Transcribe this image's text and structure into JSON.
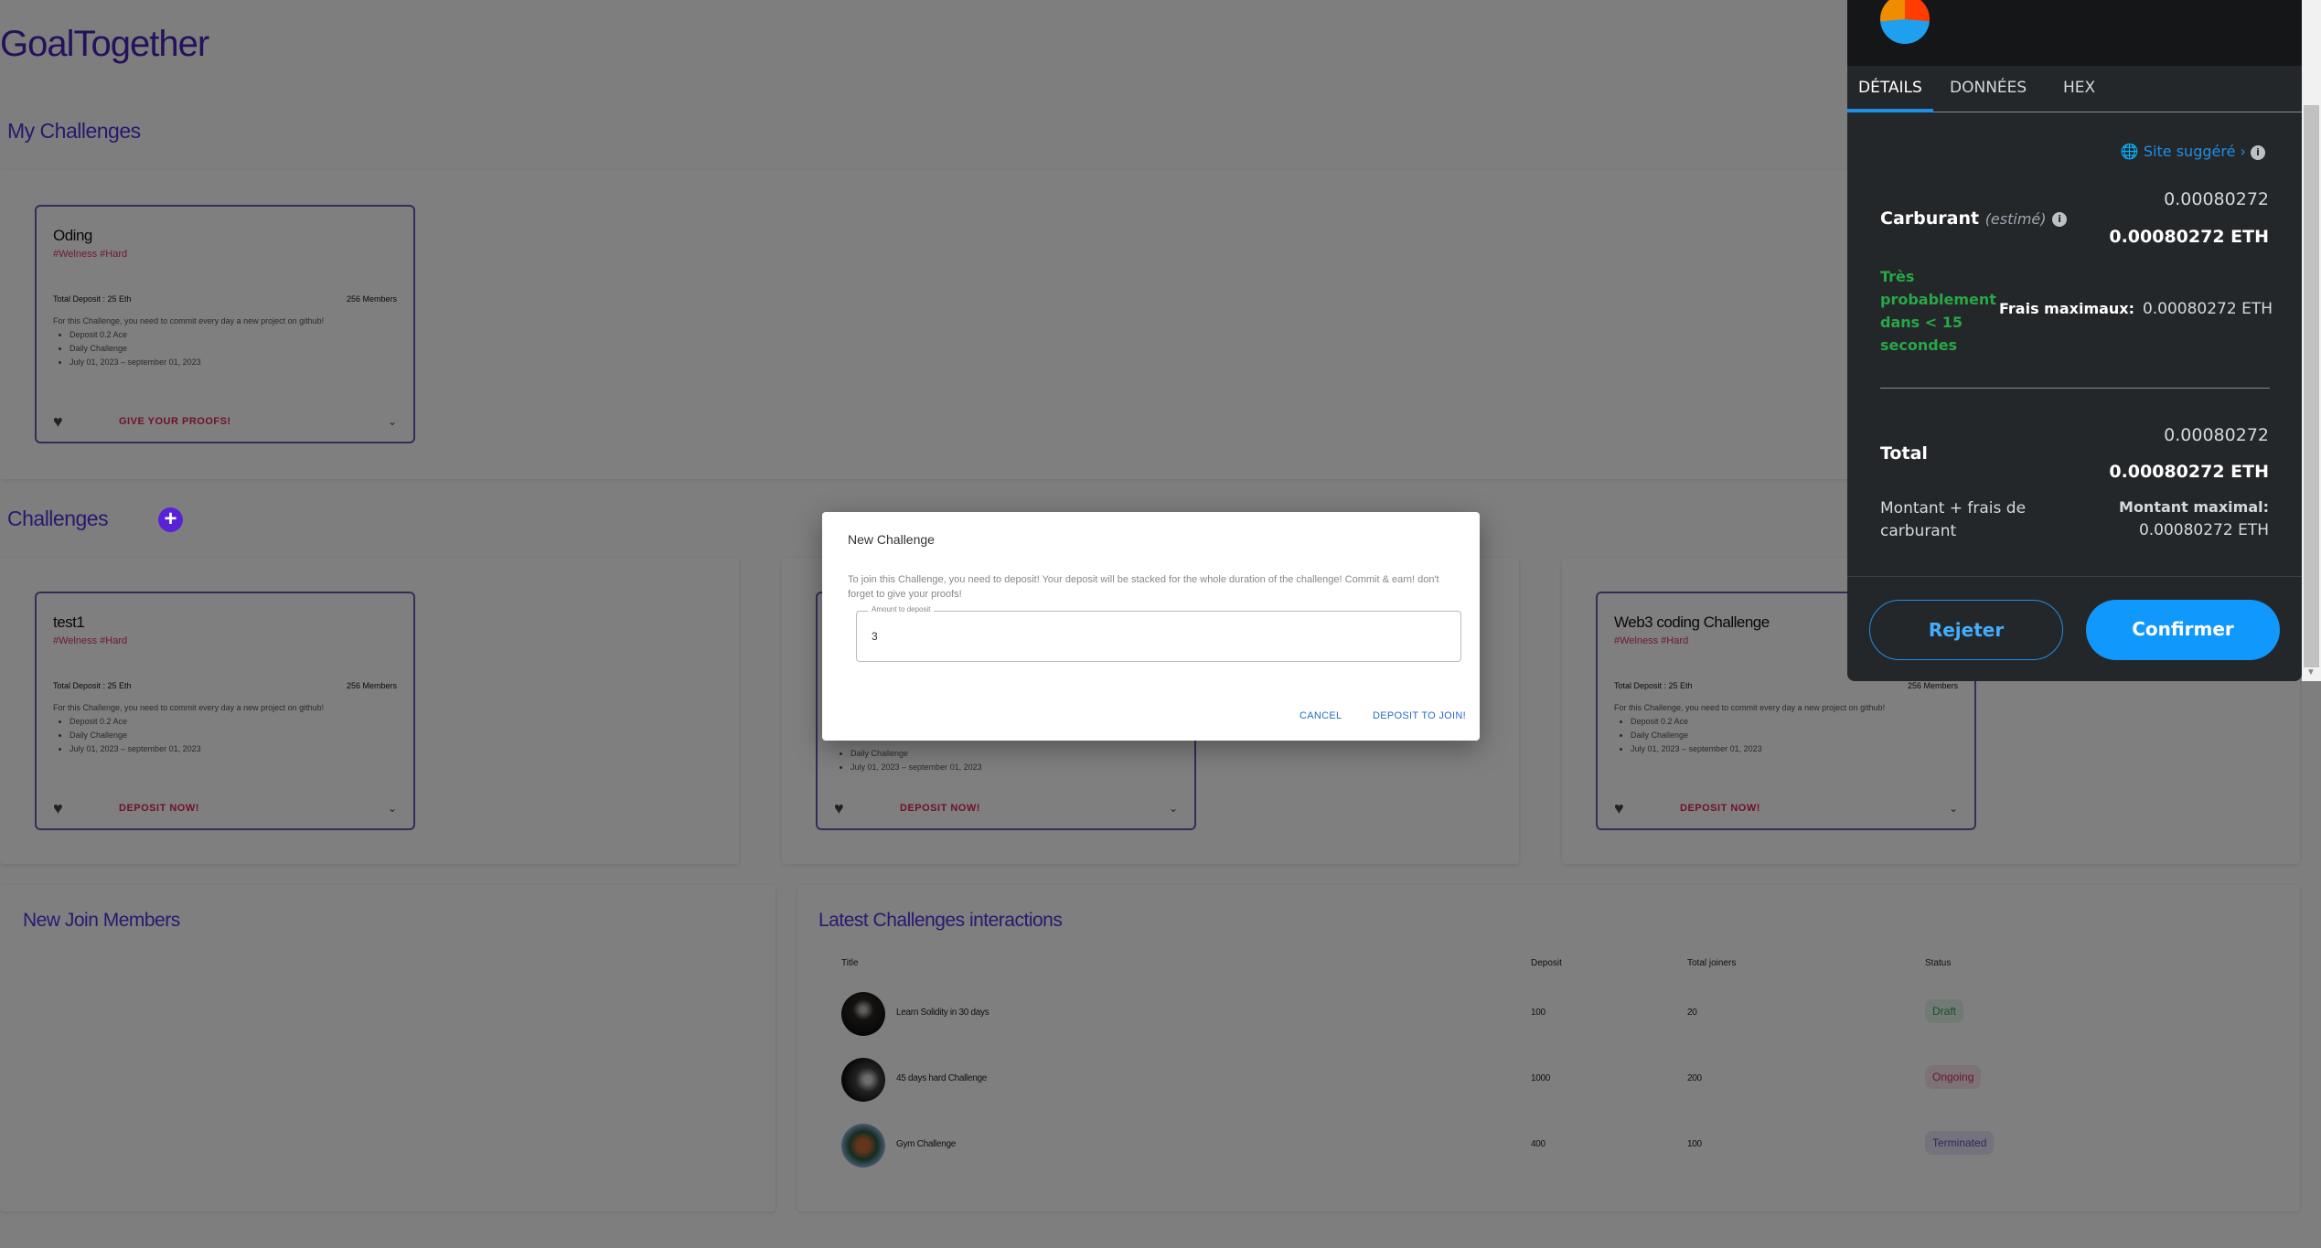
{
  "app": {
    "title": "GoalTogether"
  },
  "my_challenges": {
    "heading": "My Challenges",
    "cards": [
      {
        "title": "Oding",
        "tags": "#Welness #Hard",
        "total_deposit": "Total Deposit : 25 Eth",
        "members": "256 Members",
        "description": "For this Challenge, you need to commit every day a new project on github!",
        "bullets": [
          "Deposit 0.2 Ace",
          "Daily Challenge",
          "July 01, 2023 – september 01, 2023"
        ],
        "action": "GIVE YOUR PROOFS!"
      }
    ]
  },
  "challenges": {
    "heading": "Challenges",
    "cards": [
      {
        "title": "test1",
        "tags": "#Welness #Hard",
        "total_deposit": "Total Deposit : 25 Eth",
        "members": "256 Members",
        "description": "For this Challenge, you need to commit every day a new project on github!",
        "bullets": [
          "Deposit 0.2 Ace",
          "Daily Challenge",
          "July 01, 2023 – september 01, 2023"
        ],
        "action": "DEPOSIT NOW!"
      },
      {
        "bullets": [
          "Daily Challenge",
          "July 01, 2023 – september 01, 2023"
        ],
        "action": "DEPOSIT NOW!"
      },
      {
        "title": "Web3 coding Challenge",
        "tags": "#Welness #Hard",
        "total_deposit": "Total Deposit : 25 Eth",
        "members": "256 Members",
        "description": "For this Challenge, you need to commit every day a new project on github!",
        "bullets": [
          "Deposit 0.2 Ace",
          "Daily Challenge",
          "July 01, 2023 – september 01, 2023"
        ],
        "action": "DEPOSIT NOW!"
      }
    ]
  },
  "new_members": {
    "heading": "New Join Members"
  },
  "latest": {
    "heading": "Latest Challenges interactions",
    "columns": [
      "Title",
      "Deposit",
      "Total joiners",
      "Status"
    ],
    "rows": [
      {
        "title": "Learn Solidity in 30 days",
        "deposit": "100",
        "joiners": "20",
        "status": "Draft",
        "status_color": "#2e9e5a"
      },
      {
        "title": "45 days hard Challenge",
        "deposit": "1000",
        "joiners": "200",
        "status": "Ongoing",
        "status_color": "#d02d5a"
      },
      {
        "title": "Gym Challenge",
        "deposit": "400",
        "joiners": "100",
        "status": "Terminated",
        "status_color": "#5a4ec0"
      }
    ]
  },
  "dialog": {
    "title": "New Challenge",
    "text": "To join this Challenge, you need to deposit! Your deposit will be stacked for the whole duration of the challenge! Commit & earn! don't forget to give your proofs!",
    "field_label": "Amount to deposit",
    "field_value": "3",
    "cancel": "CANCEL",
    "confirm": "DEPOSIT TO JOIN!"
  },
  "wallet": {
    "tabs": [
      "DÉTAILS",
      "DONNÉES",
      "HEX"
    ],
    "active_tab": "DÉTAILS",
    "site_suggested": "Site suggéré",
    "gas_label": "Carburant",
    "gas_estimated": "(estimé)",
    "gas_value": "0.00080272",
    "gas_value_eth": "0.00080272 ETH",
    "likely": "Très probablement dans < 15 secondes",
    "max_fee_label": "Frais maximaux:",
    "max_fee_value": "0.00080272 ETH",
    "total_label": "Total",
    "total_value": "0.00080272",
    "total_value_eth": "0.00080272 ETH",
    "amount_plus_fee": "Montant + frais de carburant",
    "max_amount_label": "Montant maximal:",
    "max_amount_value": "0.00080272 ETH",
    "reject": "Rejeter",
    "confirm": "Confirmer",
    "accent": "#1098fc",
    "success": "#28a745"
  }
}
